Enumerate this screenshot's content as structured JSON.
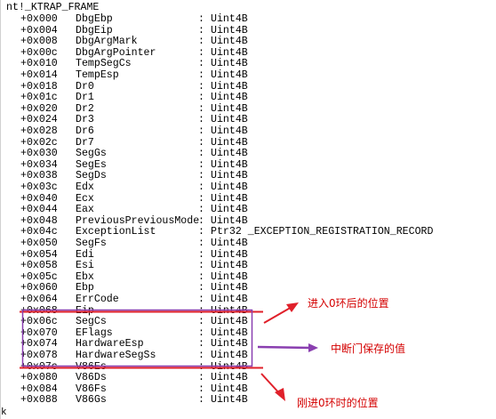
{
  "dump": {
    "header": "nt!_KTRAP_FRAME",
    "rows": [
      {
        "offset": "+0x000",
        "field": "DbgEbp",
        "sep": ":",
        "type": "Uint4B"
      },
      {
        "offset": "+0x004",
        "field": "DbgEip",
        "sep": ":",
        "type": "Uint4B"
      },
      {
        "offset": "+0x008",
        "field": "DbgArgMark",
        "sep": ":",
        "type": "Uint4B"
      },
      {
        "offset": "+0x00c",
        "field": "DbgArgPointer",
        "sep": ":",
        "type": "Uint4B"
      },
      {
        "offset": "+0x010",
        "field": "TempSegCs",
        "sep": ":",
        "type": "Uint4B"
      },
      {
        "offset": "+0x014",
        "field": "TempEsp",
        "sep": ":",
        "type": "Uint4B"
      },
      {
        "offset": "+0x018",
        "field": "Dr0",
        "sep": ":",
        "type": "Uint4B"
      },
      {
        "offset": "+0x01c",
        "field": "Dr1",
        "sep": ":",
        "type": "Uint4B"
      },
      {
        "offset": "+0x020",
        "field": "Dr2",
        "sep": ":",
        "type": "Uint4B"
      },
      {
        "offset": "+0x024",
        "field": "Dr3",
        "sep": ":",
        "type": "Uint4B"
      },
      {
        "offset": "+0x028",
        "field": "Dr6",
        "sep": ":",
        "type": "Uint4B"
      },
      {
        "offset": "+0x02c",
        "field": "Dr7",
        "sep": ":",
        "type": "Uint4B"
      },
      {
        "offset": "+0x030",
        "field": "SegGs",
        "sep": ":",
        "type": "Uint4B"
      },
      {
        "offset": "+0x034",
        "field": "SegEs",
        "sep": ":",
        "type": "Uint4B"
      },
      {
        "offset": "+0x038",
        "field": "SegDs",
        "sep": ":",
        "type": "Uint4B"
      },
      {
        "offset": "+0x03c",
        "field": "Edx",
        "sep": ":",
        "type": "Uint4B"
      },
      {
        "offset": "+0x040",
        "field": "Ecx",
        "sep": ":",
        "type": "Uint4B"
      },
      {
        "offset": "+0x044",
        "field": "Eax",
        "sep": ":",
        "type": "Uint4B"
      },
      {
        "offset": "+0x048",
        "field": "PreviousPreviousMode",
        "sep": ": Uint4B",
        "type": ""
      },
      {
        "offset": "+0x04c",
        "field": "ExceptionList",
        "sep": ":",
        "type": "Ptr32 _EXCEPTION_REGISTRATION_RECORD"
      },
      {
        "offset": "+0x050",
        "field": "SegFs",
        "sep": ":",
        "type": "Uint4B"
      },
      {
        "offset": "+0x054",
        "field": "Edi",
        "sep": ":",
        "type": "Uint4B"
      },
      {
        "offset": "+0x058",
        "field": "Esi",
        "sep": ":",
        "type": "Uint4B"
      },
      {
        "offset": "+0x05c",
        "field": "Ebx",
        "sep": ":",
        "type": "Uint4B"
      },
      {
        "offset": "+0x060",
        "field": "Ebp",
        "sep": ":",
        "type": "Uint4B"
      },
      {
        "offset": "+0x064",
        "field": "ErrCode",
        "sep": ":",
        "type": "Uint4B"
      },
      {
        "offset": "+0x068",
        "field": "Eip",
        "sep": ":",
        "type": "Uint4B"
      },
      {
        "offset": "+0x06c",
        "field": "SegCs",
        "sep": ":",
        "type": "Uint4B"
      },
      {
        "offset": "+0x070",
        "field": "EFlags",
        "sep": ":",
        "type": "Uint4B"
      },
      {
        "offset": "+0x074",
        "field": "HardwareEsp",
        "sep": ":",
        "type": "Uint4B"
      },
      {
        "offset": "+0x078",
        "field": "HardwareSegSs",
        "sep": ":",
        "type": "Uint4B"
      },
      {
        "offset": "+0x07c",
        "field": "V86Es",
        "sep": ":",
        "type": "Uint4B"
      },
      {
        "offset": "+0x080",
        "field": "V86Ds",
        "sep": ":",
        "type": "Uint4B"
      },
      {
        "offset": "+0x084",
        "field": "V86Fs",
        "sep": ":",
        "type": "Uint4B"
      },
      {
        "offset": "+0x088",
        "field": "V86Gs",
        "sep": ":",
        "type": "Uint4B"
      }
    ]
  },
  "annotations": {
    "enter_ring0_after": "进入0环后的位置",
    "interrupt_gate_saved": "中断门保存的值",
    "just_entered_ring0": "刚进0环时的位置"
  },
  "colors": {
    "red": "#e0202a",
    "purple": "#8a3fb0",
    "text_red": "#d40000"
  },
  "edge_glyph": "k"
}
